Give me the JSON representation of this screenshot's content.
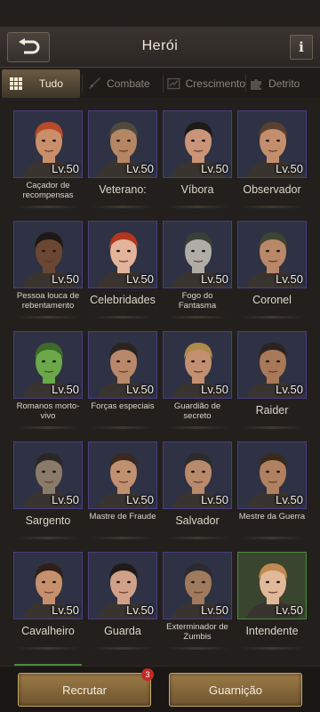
{
  "header": {
    "title": "Herói",
    "back_icon": "back-arrow-icon",
    "info_label": "i"
  },
  "tabs": [
    {
      "label": "Tudo",
      "icon": "grid-icon",
      "active": true
    },
    {
      "label": "Combate",
      "icon": "sword-icon",
      "active": false
    },
    {
      "label": "Crescimento",
      "icon": "growth-icon",
      "active": false
    },
    {
      "label": "Detrito",
      "icon": "puzzle-icon",
      "active": false
    }
  ],
  "heroes": [
    {
      "name": "Caçador de recompensas",
      "level": "Lv.50",
      "small": true,
      "skin": "#c98e6a",
      "hair": "#b84a2a"
    },
    {
      "name": "Veterano:",
      "level": "Lv.50",
      "small": false,
      "skin": "#b58663",
      "hair": "#4e4a3e"
    },
    {
      "name": "Víbora",
      "level": "Lv.50",
      "small": false,
      "skin": "#c99478",
      "hair": "#1d1a18"
    },
    {
      "name": "Observador",
      "level": "Lv.50",
      "small": false,
      "skin": "#c48e6c",
      "hair": "#5a4030"
    },
    {
      "name": "Pessoa louca de rebentamento",
      "level": "Lv.50",
      "small": true,
      "skin": "#6b4632",
      "hair": "#1e1814"
    },
    {
      "name": "Celebridades",
      "level": "Lv.50",
      "small": false,
      "skin": "#e3b39a",
      "hair": "#b3361f"
    },
    {
      "name": "Fogo do Fantasma",
      "level": "Lv.50",
      "small": true,
      "skin": "#b0aca6",
      "hair": "#3a4038"
    },
    {
      "name": "Coronel",
      "level": "Lv.50",
      "small": false,
      "skin": "#b88868",
      "hair": "#3f4432"
    },
    {
      "name": "Romanos morto-vivo",
      "level": "Lv.50",
      "small": true,
      "skin": "#6aa84a",
      "hair": "#3c6a2a"
    },
    {
      "name": "Forças especiais",
      "level": "Lv.50",
      "small": true,
      "skin": "#b8886a",
      "hair": "#2a2420"
    },
    {
      "name": "Guardião de secreto",
      "level": "Lv.50",
      "small": true,
      "skin": "#c29070",
      "hair": "#b08a4a"
    },
    {
      "name": "Raider",
      "level": "Lv.50",
      "small": false,
      "skin": "#a87858",
      "hair": "#2a2420"
    },
    {
      "name": "Sargento",
      "level": "Lv.50",
      "small": false,
      "skin": "#8a7a6a",
      "hair": "#2a2826"
    },
    {
      "name": "Mastre de Fraude",
      "level": "Lv.50",
      "small": true,
      "skin": "#c09070",
      "hair": "#3a2a20"
    },
    {
      "name": "Salvador",
      "level": "Lv.50",
      "small": false,
      "skin": "#b88a6c",
      "hair": "#2c2c2c"
    },
    {
      "name": "Mestre da Guerra",
      "level": "Lv.50",
      "small": true,
      "skin": "#b08060",
      "hair": "#3a2a1c"
    },
    {
      "name": "Cavalheiro",
      "level": "Lv.50",
      "small": false,
      "skin": "#c6906c",
      "hair": "#2e2018"
    },
    {
      "name": "Guarda",
      "level": "Lv.50",
      "small": false,
      "skin": "#d0a088",
      "hair": "#201a18"
    },
    {
      "name": "Exterminador de Zumbis",
      "level": "Lv.50",
      "small": true,
      "skin": "#a07a5c",
      "hair": "#2a2a30"
    },
    {
      "name": "Intendente",
      "level": "Lv.50",
      "small": false,
      "skin": "#e2b89a",
      "hair": "#c08a50",
      "green": true
    }
  ],
  "footer": {
    "recruit_label": "Recrutar",
    "recruit_badge": "3",
    "garrison_label": "Guarnição"
  },
  "colors": {
    "accent": "#9b7a45",
    "frame_purple": "#4a3d80",
    "frame_green": "#4a8a3c",
    "badge_red": "#c42a25"
  }
}
